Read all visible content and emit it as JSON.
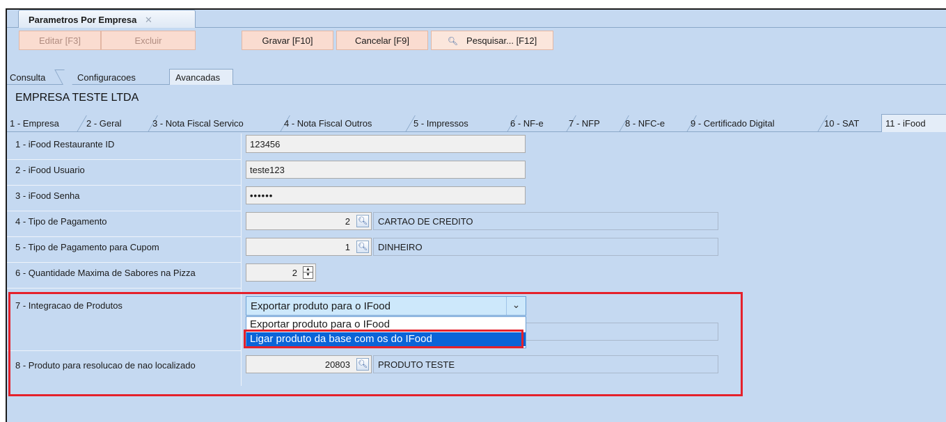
{
  "window_tab": {
    "title": "Parametros Por Empresa",
    "close": "✕"
  },
  "toolbar": {
    "edit": "Editar [F3]",
    "delete": "Excluir",
    "save": "Gravar [F10]",
    "cancel": "Cancelar [F9]",
    "search": "Pesquisar... [F12]"
  },
  "subtabs": [
    "Consulta",
    "Configuracoes",
    "Avancadas"
  ],
  "company_name": "EMPRESA TESTE LTDA",
  "form_tabs": [
    "1 - Empresa",
    "2 - Geral",
    "3 - Nota Fiscal Servico",
    "4 - Nota Fiscal Outros",
    "5 - Impressos",
    "6 - NF-e",
    "7 - NFP",
    "8 - NFC-e",
    "9 - Certificado Digital",
    "10 - SAT",
    "11 - iFood"
  ],
  "fields": {
    "restaurant_id": {
      "label": "1 - iFood Restaurante ID",
      "value": "123456"
    },
    "user": {
      "label": "2 - iFood Usuario",
      "value": "teste123"
    },
    "password": {
      "label": "3 - iFood Senha",
      "value": "••••••"
    },
    "payment_type": {
      "label": "4 - Tipo de Pagamento",
      "value": "2",
      "description": "CARTAO DE CREDITO"
    },
    "coupon_payment_type": {
      "label": "5 - Tipo de Pagamento para Cupom",
      "value": "1",
      "description": "DINHEIRO"
    },
    "max_flavors": {
      "label": "6 - Quantidade Maxima de Sabores na Pizza",
      "value": "2"
    },
    "product_integration": {
      "label": "7 - Integracao de Produtos",
      "selected": "Exportar produto para o IFood",
      "options": [
        "Exportar produto para o IFood",
        "Ligar produto da base com os do IFood"
      ]
    },
    "not_found_product": {
      "label": "8 - Produto para resolucao de nao localizado",
      "value": "20803",
      "description": "PRODUTO TESTE"
    }
  },
  "colors": {
    "background": "#c5d9f1",
    "button": "#fadcd0",
    "highlight": "#e5212b",
    "selected_option": "#0a64d8"
  }
}
